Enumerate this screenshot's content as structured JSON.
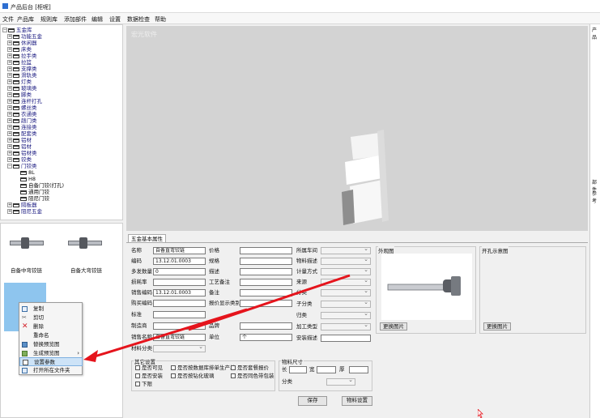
{
  "window": {
    "title": "产品后台 [柜呢]"
  },
  "menu": [
    "文件",
    "产品库",
    "规则库",
    "添加部件",
    "编辑",
    "设置",
    "数据检查",
    "帮助"
  ],
  "tree": {
    "root": "五金库",
    "items": [
      {
        "label": "功能五金"
      },
      {
        "label": "休闲器"
      },
      {
        "label": "床类"
      },
      {
        "label": "拉手类"
      },
      {
        "label": "拉篮"
      },
      {
        "label": "支撑类"
      },
      {
        "label": "滑轨类"
      },
      {
        "label": "灯类"
      },
      {
        "label": "玻璃类"
      },
      {
        "label": "脚类"
      },
      {
        "label": "连杆打孔"
      },
      {
        "label": "螺丝类"
      },
      {
        "label": "衣通类"
      },
      {
        "label": "趟门类"
      },
      {
        "label": "连接类"
      },
      {
        "label": "配套类"
      },
      {
        "label": "铝材"
      },
      {
        "label": "铝材"
      },
      {
        "label": "铝材类"
      },
      {
        "label": "铰类"
      },
      {
        "label": "门铰类"
      }
    ],
    "children": [
      {
        "label": "8L"
      },
      {
        "label": "H8"
      },
      {
        "label": "自备门铰(打孔)"
      },
      {
        "label": "通用门铰"
      },
      {
        "label": "阻尼门铰"
      }
    ],
    "after": [
      {
        "label": "隔板器"
      },
      {
        "label": "阻尼五金"
      }
    ]
  },
  "thumbs": [
    {
      "label": "自备中弯铰链"
    },
    {
      "label": "自备大弯铰链"
    }
  ],
  "context_menu": {
    "items": [
      {
        "label": "复制"
      },
      {
        "label": "剪切"
      },
      {
        "label": "删除"
      },
      {
        "label": "重命名"
      },
      {
        "label": "替换预览图"
      },
      {
        "label": "生成预览图"
      },
      {
        "label": "设置参数"
      },
      {
        "label": "打开所在文件夹"
      }
    ],
    "submenu_arrow": "›"
  },
  "viewer": {
    "watermark": "宏光软件"
  },
  "right_panel": {
    "top_label": "产品",
    "mid_label": "部件",
    "sub_label": "参考"
  },
  "props": {
    "tab": "五金基本属性",
    "fields": {
      "name_label": "名称",
      "name_value": "自备直弯铰链",
      "code_label": "编码",
      "code_value": "13.12.01.0003",
      "qty_label": "多发数量",
      "qty_value": "0",
      "loss_label": "损耗率",
      "loss_value": "",
      "sales_code_label": "销售编码",
      "sales_code_value": "13.12.01.0003",
      "purchase_label": "购买编码",
      "purchase_value": "",
      "mark_label": "标准",
      "mark_value": "",
      "maker_label": "制造商",
      "maker_value": "",
      "sales_name_label": "销售名称",
      "sales_name_value": "自备直弯铰链",
      "material_cat_label": "材料分类",
      "price_label": "价格",
      "price_value": "",
      "spec_label": "规格",
      "spec_value": "",
      "desc_label": "描述",
      "desc_value": "",
      "craft_note_label": "工艺备注",
      "craft_note_value": "",
      "note_label": "备注",
      "note_value": "",
      "quote_label": "报价显示类别",
      "quote_value": "",
      "brand_label": "品牌",
      "brand_value": "",
      "unit_label": "单位",
      "unit_value": "个",
      "station_label": "所属车间",
      "material_label": "物料描述",
      "calc_label": "计量方式",
      "source_label": "来源",
      "category_label": "分类",
      "subcat_label": "子分类",
      "sub2_label": "归类",
      "process_label": "加工类型",
      "install_label": "安装描述"
    },
    "image_groups": {
      "outline_label": "外观图",
      "hole_label": "开孔示意图",
      "change_btn": "更换图片"
    },
    "other": {
      "title": "其它设置",
      "checks": [
        {
          "label": "是否可见"
        },
        {
          "label": "是否按数据库排单生产单"
        },
        {
          "label": "是否套餐报价"
        },
        {
          "label": "是否安装"
        },
        {
          "label": "是否按钻化玻璃"
        },
        {
          "label": "是否同色带包装"
        },
        {
          "label": "下限"
        }
      ]
    },
    "size": {
      "title": "物料尺寸",
      "len_label": "长",
      "width_label": "宽",
      "thick_label": "厚",
      "cat_label": "分类"
    },
    "save_btn": "保存",
    "material_btn": "物料设置"
  },
  "colors": {
    "accent_arrow": "#e5141c",
    "select": "#8ec5ee",
    "highlight": "#cde3f7"
  }
}
